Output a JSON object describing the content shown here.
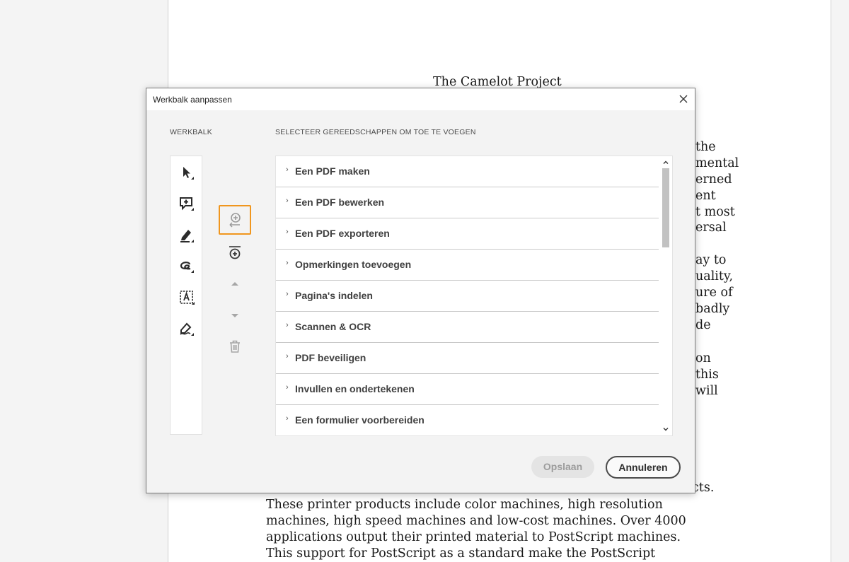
{
  "document": {
    "title": "The Camelot Project",
    "right_fragments": [
      "the",
      "mental",
      "erned",
      "ent",
      "t most",
      "ersal",
      "ay to",
      "uality,",
      "ure of",
      "badly",
      "de",
      "on",
      "this",
      "will"
    ],
    "bottom_partial": "cts.",
    "bottom_lines": [
      "These printer products include color machines, high resolution",
      "machines, high speed machines and low-cost machines. Over 4000",
      "applications output their printed material to PostScript machines.",
      "This support for PostScript as a standard make the PostScript"
    ]
  },
  "dialog": {
    "title": "Werkbalk aanpassen",
    "toolbar_heading": "WERKBALK",
    "tools_heading": "SELECTEER GEREEDSCHAPPEN OM TOE TE VOEGEN",
    "toolbar_tools": [
      {
        "icon": "select-arrow-icon"
      },
      {
        "icon": "add-comment-icon"
      },
      {
        "icon": "highlight-pen-icon"
      },
      {
        "icon": "lasso-icon"
      },
      {
        "icon": "text-box-icon"
      },
      {
        "icon": "sign-pen-icon"
      }
    ],
    "actions": [
      {
        "icon": "add-tool-icon",
        "selected": true
      },
      {
        "icon": "add-divider-icon",
        "selected": false
      },
      {
        "icon": "move-up-icon",
        "selected": false
      },
      {
        "icon": "move-down-icon",
        "selected": false
      },
      {
        "icon": "trash-icon",
        "selected": false
      }
    ],
    "tool_categories": [
      "Een PDF maken",
      "Een PDF bewerken",
      "Een PDF exporteren",
      "Opmerkingen toevoegen",
      "Pagina's indelen",
      "Scannen & OCR",
      "PDF beveiligen",
      "Invullen en ondertekenen",
      "Een formulier voorbereiden"
    ],
    "chevron": "›",
    "save_label": "Opslaan",
    "cancel_label": "Annuleren",
    "colors": {
      "selected_outline": "#f0961e",
      "scroll_thumb": "#c2c2c2"
    }
  }
}
